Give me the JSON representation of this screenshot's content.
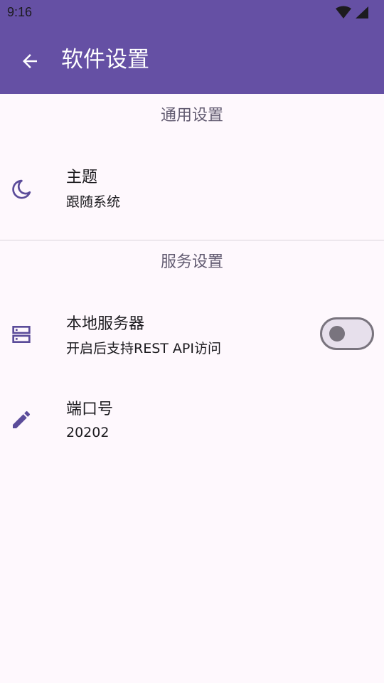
{
  "status_bar": {
    "time": "9:16"
  },
  "app_bar": {
    "title": "软件设置",
    "back_icon": "arrow-back-icon",
    "color": "#6550A4"
  },
  "sections": [
    {
      "header": "通用设置",
      "items": [
        {
          "icon": "moon-icon",
          "title": "主题",
          "summary": "跟随系统"
        }
      ]
    },
    {
      "header": "服务设置",
      "items": [
        {
          "icon": "server-icon",
          "title": "本地服务器",
          "summary": "开启后支持REST API访问",
          "switch_on": false
        },
        {
          "icon": "pencil-icon",
          "title": "端口号",
          "summary": "20202"
        }
      ]
    }
  ],
  "colors": {
    "accent": "#6550A4",
    "icon_tint": "#5B4C9A",
    "section_header": "#625B71",
    "background": "#FEF8FD"
  }
}
